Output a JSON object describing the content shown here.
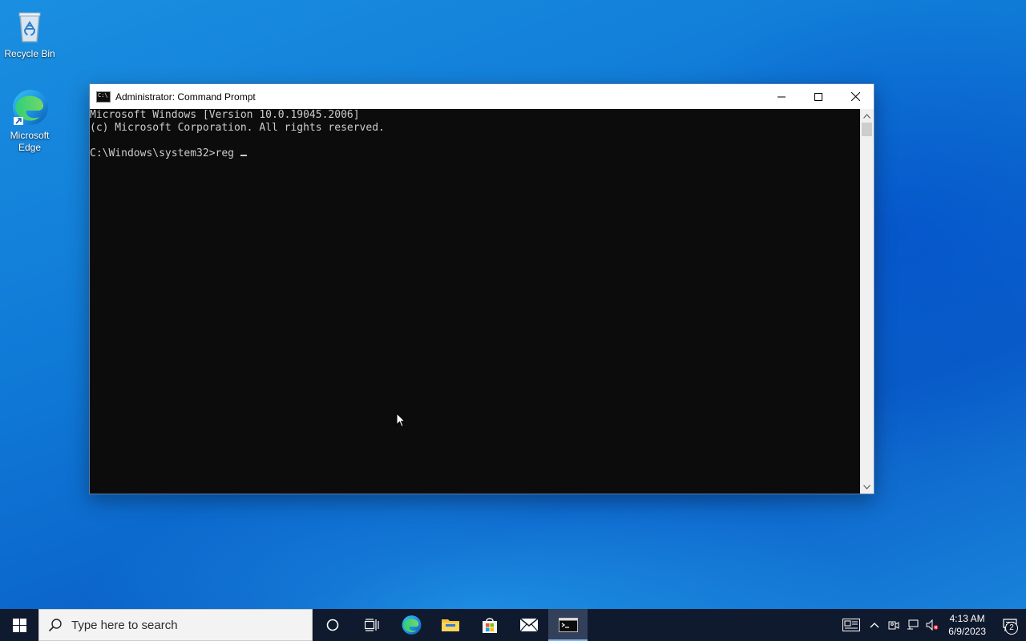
{
  "desktop": {
    "icons": [
      {
        "label": "Recycle Bin"
      },
      {
        "label": "Microsoft Edge"
      }
    ]
  },
  "window": {
    "title": "Administrator: Command Prompt",
    "app_icon_text": "C:\\",
    "console_lines": [
      "Microsoft Windows [Version 10.0.19045.2006]",
      "(c) Microsoft Corporation. All rights reserved.",
      "",
      "C:\\Windows\\system32>reg"
    ]
  },
  "taskbar": {
    "search_placeholder": "Type here to search",
    "pinned": [
      "task-view",
      "edge",
      "file-explorer",
      "microsoft-store",
      "mail",
      "command-prompt"
    ],
    "active_app": "command-prompt"
  },
  "tray": {
    "time": "4:13 AM",
    "date": "6/9/2023",
    "notification_count": "2"
  }
}
